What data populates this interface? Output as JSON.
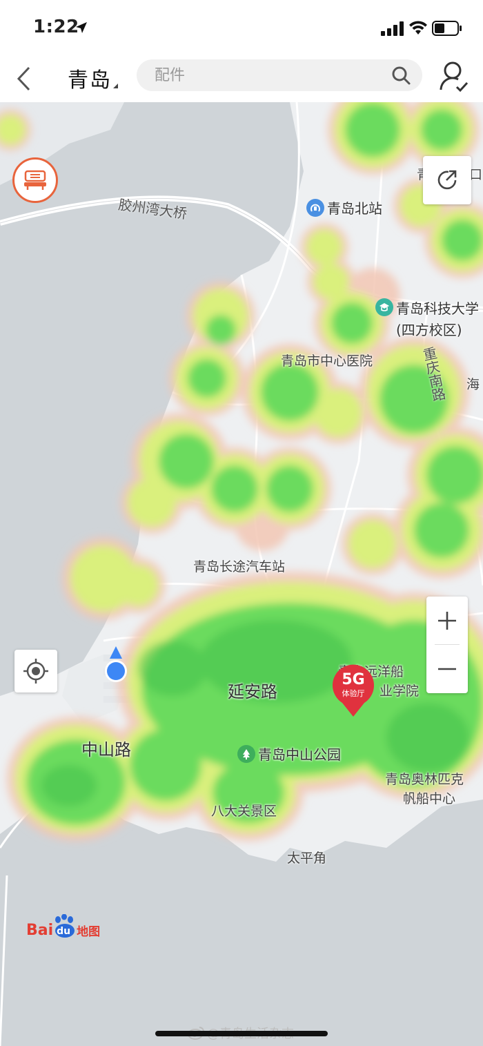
{
  "status_bar": {
    "time": "1:22"
  },
  "nav": {
    "city": "青岛",
    "search_placeholder": "配件"
  },
  "map": {
    "labels": {
      "bridge": "胶州湾大桥",
      "station_north": "青岛北站",
      "university_line1": "青岛科技大学",
      "university_line2": "(四方校区)",
      "hospital": "青岛市中心医院",
      "chongqing_road": "重庆南路",
      "hai": "海",
      "qing_fragment": "青",
      "kou_fragment": "口",
      "bus_station": "青岛长途汽车站",
      "yanan_road": "延安路",
      "ocean_college": "青岛远洋船",
      "ocean_college_sub": "业学院",
      "zhongshan_road": "中山路",
      "zhongshan_park": "青岛中山公园",
      "sailing_line1": "青岛奥林匹克",
      "sailing_line2": "帆船中心",
      "badaguan": "八大关景区",
      "taipingjiao": "太平角"
    },
    "shop_badge": {
      "big": "5G",
      "small": "体验厅"
    },
    "baidu": {
      "brand_left": "Bai",
      "brand_du": "du",
      "brand_right": "地图"
    }
  },
  "watermark": "@青岛生活杂志",
  "colors": {
    "heat_green": "#5fd85a",
    "heat_yellow": "#d9f27a",
    "heat_edge": "#f3c7b4",
    "water": "#cfd4d8",
    "land": "#eef0f2",
    "accent_orange": "#e8643c",
    "location_blue": "#3d87f5",
    "shop_red": "#e0323e"
  }
}
